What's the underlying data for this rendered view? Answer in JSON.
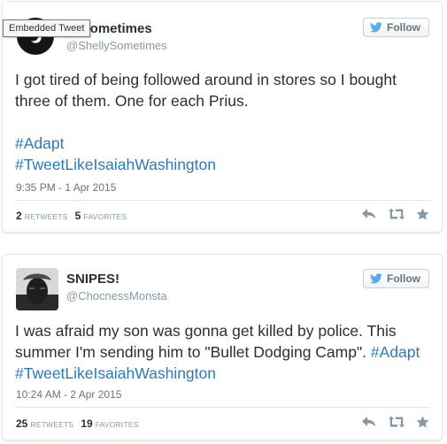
{
  "tooltip": "Embedded Tweet",
  "tweets": [
    {
      "display_name": "Shelly Sometimes",
      "display_name_visible": "ly Sometimes",
      "handle": "@ShellySometimes",
      "follow_label": "Follow",
      "text": "I got tired of being followed around in stores so I bought three of them. One for each Prius.",
      "hashtags": [
        "#Adapt",
        "#TweetLikeIsaiahWashington"
      ],
      "timestamp": "9:35 PM - 1 Apr 2015",
      "retweets": "2",
      "retweets_label": "RETWEETS",
      "favorites": "5",
      "favorites_label": "FAVORITES"
    },
    {
      "display_name": "SNIPES!",
      "handle": "@ChocnessMonsta",
      "follow_label": "Follow",
      "text": "I was afraid my son was gonna get killed by police. This summer I'm sending him to \"Bullet Dodging Camp\".",
      "hashtags": [
        "#Adapt",
        "#TweetLikeIsaiahWashington"
      ],
      "timestamp": "10:24 AM - 2 Apr 2015",
      "retweets": "25",
      "retweets_label": "RETWEETS",
      "favorites": "19",
      "favorites_label": "FAVORITES"
    }
  ],
  "colors": {
    "link": "#2b7bb9",
    "twitter_bird": "#55acee",
    "text": "#292f33",
    "muted": "#8899a6",
    "action_icon": "#8899a6"
  },
  "icons": {
    "follow": "twitter-bird-icon",
    "reply": "reply-icon",
    "retweet": "retweet-icon",
    "favorite": "star-icon"
  }
}
